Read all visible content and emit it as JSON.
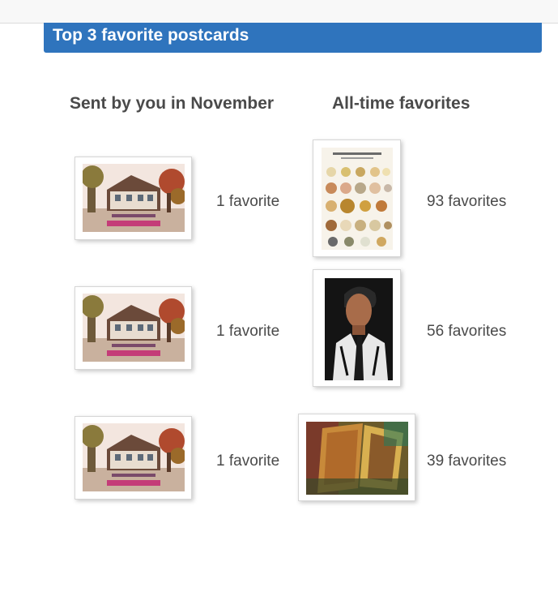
{
  "header": {
    "title": "Top 3 favorite postcards"
  },
  "columns": {
    "sent_heading": "Sent by you in November",
    "alltime_heading": "All-time favorites"
  },
  "sent": [
    {
      "count": "1 favorite",
      "image": "house-postcard-image",
      "caption": "145-Jubiläumsabend"
    },
    {
      "count": "1 favorite",
      "image": "house-postcard-image",
      "caption": "145-Jubiläumsabend"
    },
    {
      "count": "1 favorite",
      "image": "house-postcard-image",
      "caption": "145-Jubiläumsabend"
    }
  ],
  "alltime": [
    {
      "count": "93 favorites",
      "image": "cheese-chart-postcard-image",
      "caption": "LES FROMAGES DE FRANCE"
    },
    {
      "count": "56 favorites",
      "image": "portrait-postcard-image"
    },
    {
      "count": "39 favorites",
      "image": "abstract-painting-postcard-image"
    }
  ],
  "colors": {
    "header_bg": "#2f74bd",
    "text": "#4a4a4a"
  }
}
